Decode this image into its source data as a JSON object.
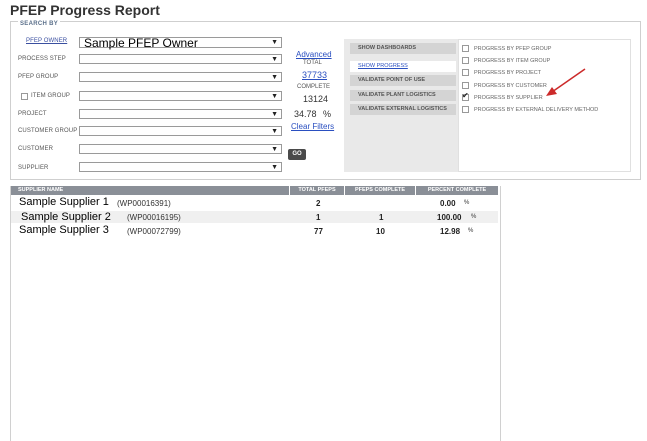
{
  "page": {
    "title": "PFEP Progress Report"
  },
  "search": {
    "legend": "SEARCH BY",
    "fields": [
      {
        "key": "pfep_owner",
        "label": "PFEP OWNER",
        "value": "Sample PFEP Owner"
      },
      {
        "key": "process_step",
        "label": "PROCESS STEP",
        "value": ""
      },
      {
        "key": "pfep_group",
        "label": "PFEP GROUP",
        "value": ""
      },
      {
        "key": "item_group",
        "label": "ITEM GROUP",
        "value": ""
      },
      {
        "key": "project",
        "label": "PROJECT",
        "value": ""
      },
      {
        "key": "customer_group",
        "label": "CUSTOMER GROUP",
        "value": ""
      },
      {
        "key": "customer",
        "label": "CUSTOMER",
        "value": ""
      },
      {
        "key": "supplier",
        "label": "SUPPLIER",
        "value": ""
      }
    ],
    "advanced": "Advanced",
    "total_label": "TOTAL",
    "total_value": "37733",
    "complete_label": "COMPLETE",
    "complete_value": "13124",
    "percent_value": "34.78",
    "percent_sign": "%",
    "clear_filters": "Clear Filters",
    "go": "GO"
  },
  "panel": {
    "buttons": [
      {
        "label": "SHOW DASHBOARDS",
        "active": false
      },
      {
        "label": "SHOW PROGRESS",
        "active": true
      },
      {
        "label": "VALIDATE POINT OF USE",
        "active": false
      },
      {
        "label": "VALIDATE PLANT LOGISTICS",
        "active": false
      },
      {
        "label": "VALIDATE EXTERNAL LOGISTICS",
        "active": false
      }
    ],
    "options": [
      {
        "label": "PROGRESS BY PFEP GROUP",
        "checked": false
      },
      {
        "label": "PROGRESS BY ITEM GROUP",
        "checked": false
      },
      {
        "label": "PROGRESS BY PROJECT",
        "checked": false
      },
      {
        "label": "PROGRESS BY CUSTOMER",
        "checked": false
      },
      {
        "label": "PROGRESS BY SUPPLIER",
        "checked": true
      },
      {
        "label": "PROGRESS BY EXTERNAL DELIVERY METHOD",
        "checked": false
      }
    ],
    "annotation_color": "#cc2a2a"
  },
  "table": {
    "columns": [
      "SUPPLIER NAME",
      "TOTAL PFEPS",
      "PFEPS COMPLETE",
      "PERCENT COMPLETE"
    ],
    "rows": [
      {
        "name": "Sample Supplier 1",
        "code": "(WP00016391)",
        "total": "2",
        "complete": "",
        "percent": "0.00",
        "unit": "%"
      },
      {
        "name": "Sample Supplier 2",
        "code": "(WP00016195)",
        "total": "1",
        "complete": "1",
        "percent": "100.00",
        "unit": "%"
      },
      {
        "name": "Sample Supplier 3",
        "code": "(WP00072799)",
        "total": "77",
        "complete": "10",
        "percent": "12.98",
        "unit": "%"
      }
    ],
    "header_color": "#8a8f97"
  }
}
